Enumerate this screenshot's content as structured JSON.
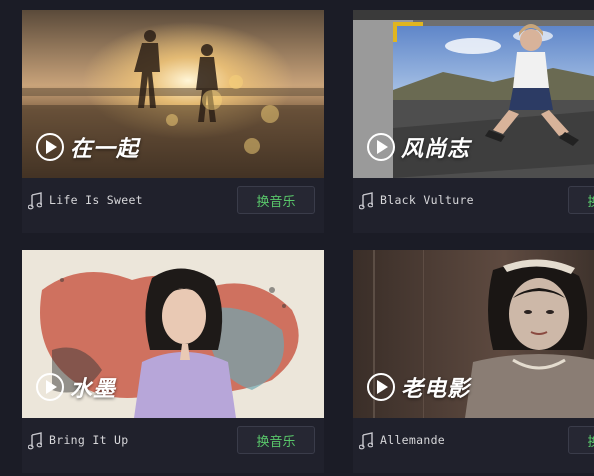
{
  "colors": {
    "page_background": "#1b1c26",
    "card_background": "#20212c",
    "button_text": "#59c76a",
    "song_text": "#d7d7da"
  },
  "templates": [
    {
      "theme_title": "在一起",
      "song": "Life Is Sweet",
      "change_music_label": "换音乐",
      "play_icon": "play-circle-icon",
      "music_icon": "music-note-icon"
    },
    {
      "theme_title": "风尚志",
      "song": "Black Vulture",
      "change_music_label": "换音乐",
      "play_icon": "play-circle-icon",
      "music_icon": "music-note-icon"
    },
    {
      "theme_title": "水墨",
      "song": "Bring It Up",
      "change_music_label": "换音乐",
      "play_icon": "play-circle-icon",
      "music_icon": "music-note-icon"
    },
    {
      "theme_title": "老电影",
      "song": "Allemande",
      "change_music_label": "换音乐",
      "play_icon": "play-circle-icon",
      "music_icon": "music-note-icon"
    }
  ]
}
